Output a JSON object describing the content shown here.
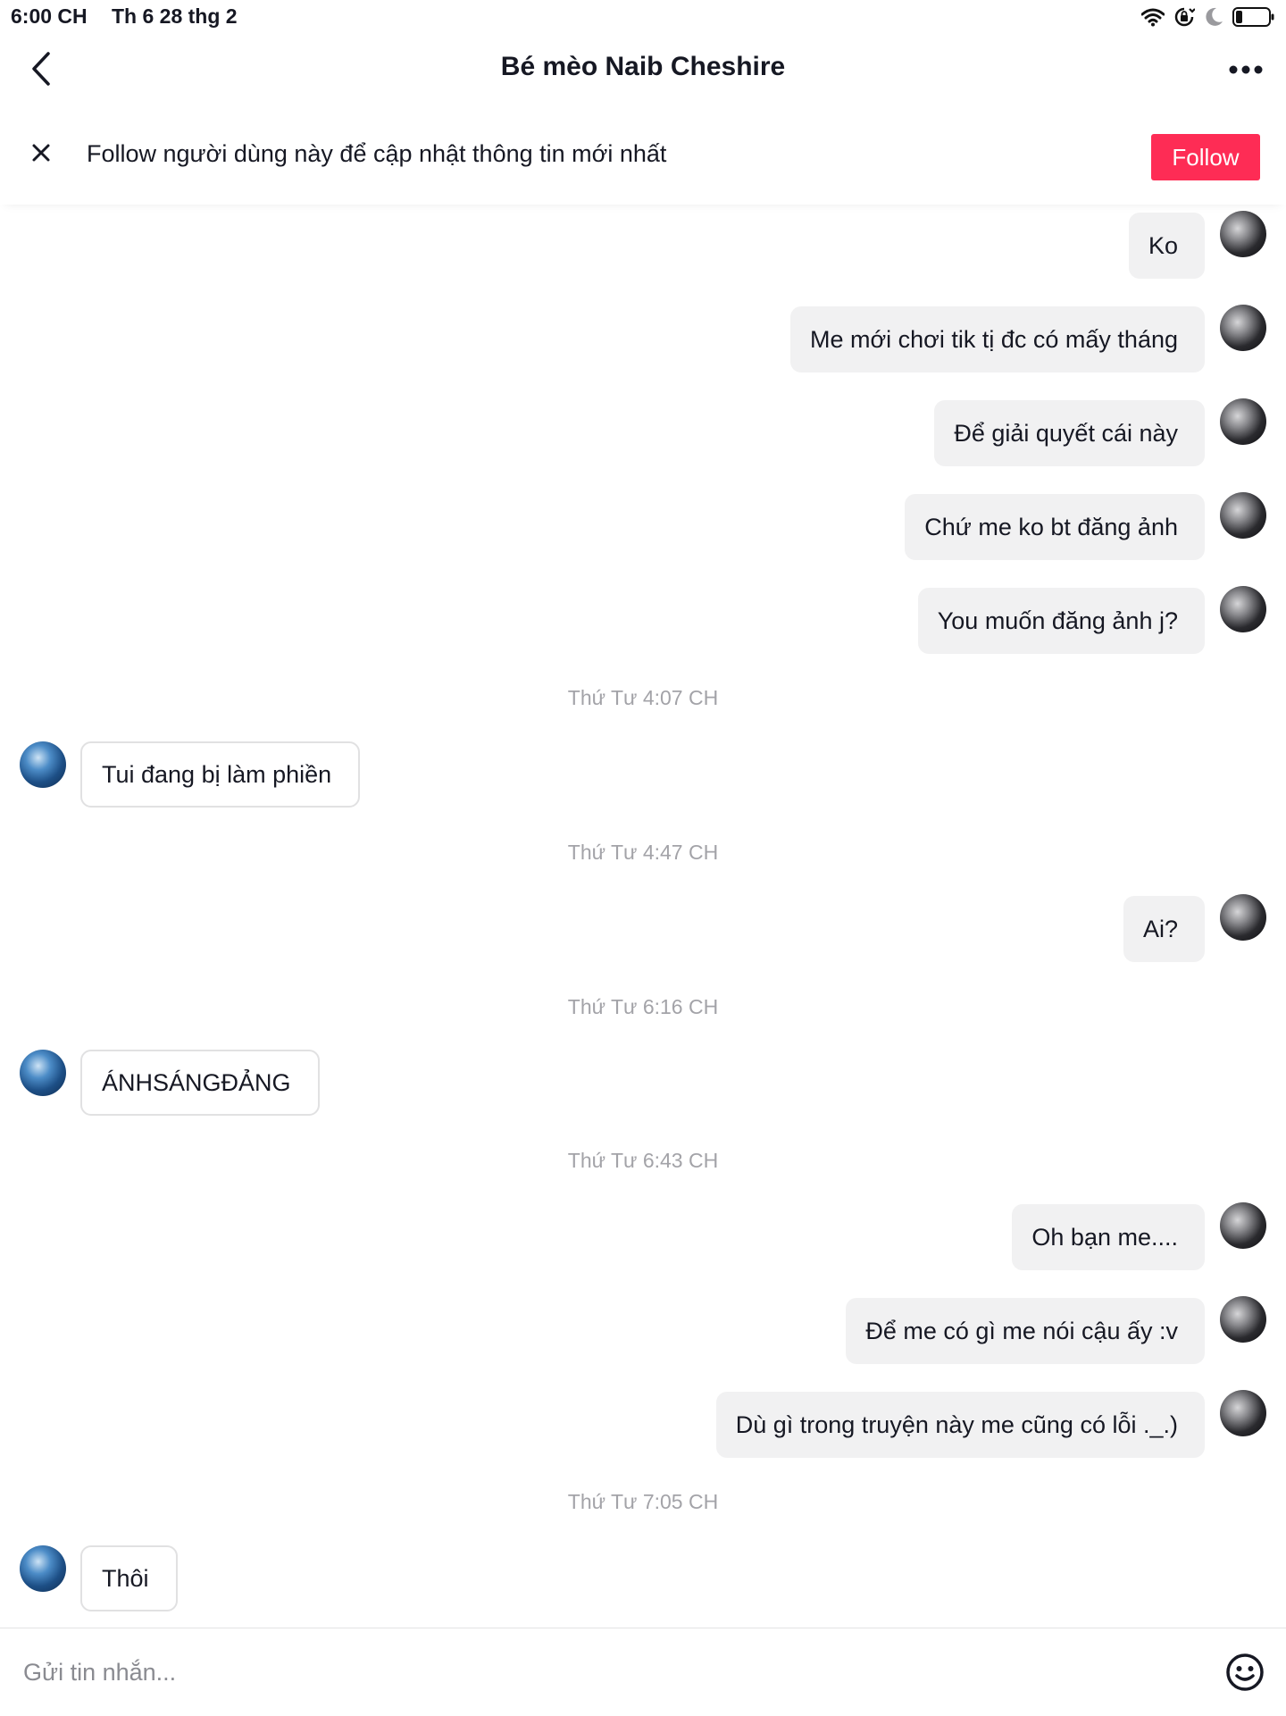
{
  "status_bar": {
    "time": "6:00 CH",
    "date": "Th 6 28 thg 2",
    "icons": [
      "wifi-icon",
      "orientation-lock-icon",
      "moon-icon",
      "battery-icon"
    ]
  },
  "header": {
    "title": "Bé mèo Naib Cheshire",
    "back_icon": "chevron-left-icon",
    "more_icon": "more-horizontal-icon"
  },
  "follow_banner": {
    "text": "Follow người dùng này để cập nhật thông tin mới nhất",
    "button_label": "Follow",
    "accent_color": "#fe2c55"
  },
  "messages": [
    {
      "type": "out",
      "text": "Ko"
    },
    {
      "type": "out",
      "text": "Me mới chơi tik tị đc có mấy tháng"
    },
    {
      "type": "out",
      "text": "Để giải quyết cái này"
    },
    {
      "type": "out",
      "text": "Chứ me ko bt đăng ảnh"
    },
    {
      "type": "out",
      "text": "You muốn đăng ảnh j?"
    },
    {
      "type": "time",
      "text": "Thứ Tư 4:07 CH"
    },
    {
      "type": "in",
      "text": "Tui đang bị làm phiền"
    },
    {
      "type": "time",
      "text": "Thứ Tư 4:47 CH"
    },
    {
      "type": "out",
      "text": "Ai?"
    },
    {
      "type": "time",
      "text": "Thứ Tư 6:16 CH"
    },
    {
      "type": "in",
      "text": "ÁNHSÁNGĐẢNG"
    },
    {
      "type": "time",
      "text": "Thứ Tư 6:43 CH"
    },
    {
      "type": "out",
      "text": "Oh bạn me...."
    },
    {
      "type": "out",
      "text": "Để me có gì me nói cậu ấy :v"
    },
    {
      "type": "out",
      "text": "Dù gì trong truyện này me cũng có lỗi ._.)"
    },
    {
      "type": "time",
      "text": "Thứ Tư 7:05 CH"
    },
    {
      "type": "in",
      "text": "Thôi"
    }
  ],
  "input_bar": {
    "placeholder": "Gửi tin nhắn...",
    "value": "",
    "emoji_icon": "emoji-smile-icon"
  }
}
